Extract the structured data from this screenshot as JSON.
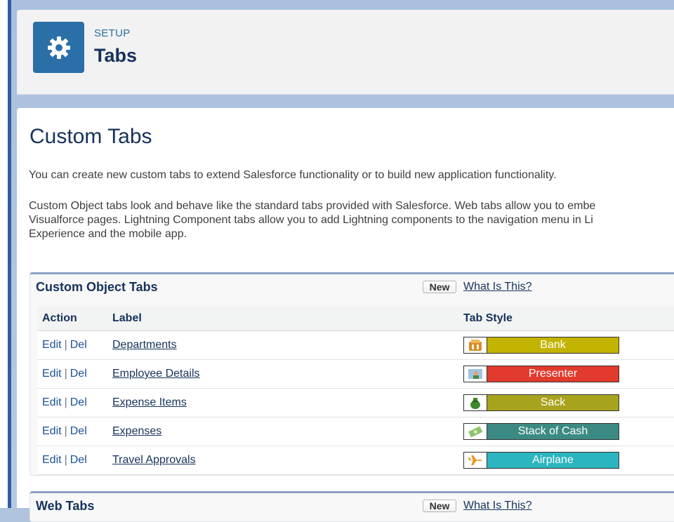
{
  "header": {
    "eyebrow": "SETUP",
    "title": "Tabs",
    "icon": "gear-icon",
    "icon_color": "#2a6fa8"
  },
  "page": {
    "title": "Custom Tabs",
    "intro": "You can create new custom tabs to extend Salesforce functionality or to build new application functionality.",
    "description_lines": [
      "Custom Object tabs look and behave like the standard tabs provided with Salesforce. Web tabs allow you to embe",
      "Visualforce pages. Lightning Component tabs allow you to add Lightning components to the navigation menu in Li",
      "Experience and the mobile app."
    ]
  },
  "custom_object_tabs": {
    "title": "Custom Object Tabs",
    "new_label": "New",
    "help_label": "What Is This?",
    "columns": [
      "Action",
      "Label",
      "Tab Style"
    ],
    "edit_label": "Edit",
    "del_label": "Del",
    "separator": "|",
    "rows": [
      {
        "label": "Departments",
        "style": "Bank",
        "color": "#c2b400",
        "icon": "bank-icon"
      },
      {
        "label": "Employee Details",
        "style": "Presenter",
        "color": "#e23a2c",
        "icon": "presenter-icon"
      },
      {
        "label": "Expense Items",
        "style": "Sack",
        "color": "#a8a31c",
        "icon": "sack-icon"
      },
      {
        "label": "Expenses",
        "style": "Stack of Cash",
        "color": "#3b8b84",
        "icon": "cash-icon"
      },
      {
        "label": "Travel Approvals",
        "style": "Airplane",
        "color": "#2bb5c0",
        "icon": "airplane-icon"
      }
    ]
  },
  "web_tabs": {
    "title": "Web Tabs",
    "new_label": "New",
    "help_label": "What Is This?"
  }
}
